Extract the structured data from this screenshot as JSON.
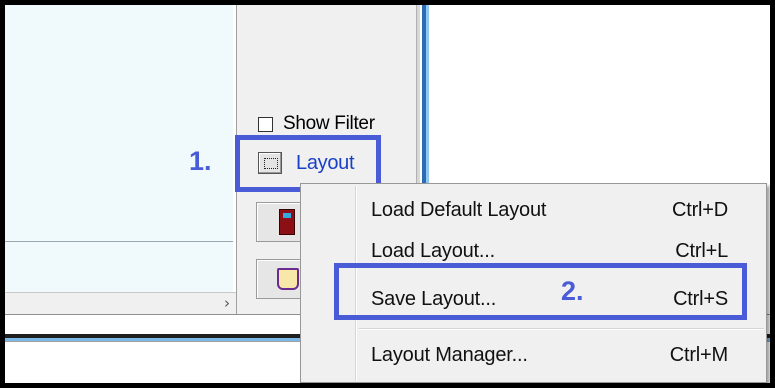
{
  "panel": {
    "show_filter_label": "Show Filter",
    "show_filter_checked": false,
    "layout_label": "Layout"
  },
  "icons": {
    "layout": "layout-icon",
    "checkbox": "checkbox-icon",
    "door": "exit-door-icon",
    "book": "book-icon",
    "scroll_right": "chevron-right-icon"
  },
  "scroll_arrow": "›",
  "annotations": {
    "step1": "1.",
    "step2": "2.",
    "color": "#4a5bd8"
  },
  "context_menu": {
    "items": [
      {
        "label": "Load Default Layout",
        "shortcut": "Ctrl+D"
      },
      {
        "label": "Load Layout...",
        "shortcut": "Ctrl+L"
      },
      {
        "label": "Save Layout...",
        "shortcut": "Ctrl+S"
      },
      {
        "label": "Layout Manager...",
        "shortcut": "Ctrl+M"
      }
    ]
  },
  "colors": {
    "link_blue": "#1a3fc7",
    "panel_bg": "#f0f0f0",
    "list_bg": "#f0fafd"
  }
}
